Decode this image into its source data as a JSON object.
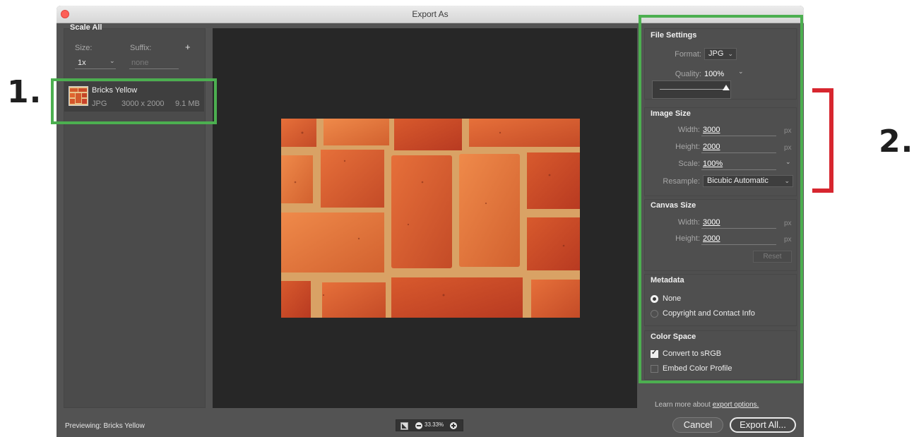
{
  "window": {
    "title": "Export As"
  },
  "annotations": {
    "label1": "1.",
    "label2": "2."
  },
  "left_panel": {
    "group_title": "Scale All",
    "size_label": "Size:",
    "suffix_label": "Suffix:",
    "add_symbol": "+",
    "size_value": "1x",
    "suffix_placeholder": "none",
    "asset": {
      "name": "Bricks Yellow",
      "format": "JPG",
      "dimensions": "3000 x 2000",
      "file_size": "9.1 MB"
    }
  },
  "file_settings": {
    "title": "File Settings",
    "format_label": "Format:",
    "format_value": "JPG",
    "quality_label": "Quality:",
    "quality_value": "100%",
    "quality_level": 1.0
  },
  "image_size": {
    "title": "Image Size",
    "width_label": "Width:",
    "width_value": "3000",
    "height_label": "Height:",
    "height_value": "2000",
    "scale_label": "Scale:",
    "scale_value": "100%",
    "resample_label": "Resample:",
    "resample_value": "Bicubic Automatic",
    "unit": "px"
  },
  "canvas_size": {
    "title": "Canvas Size",
    "width_label": "Width:",
    "width_value": "3000",
    "height_label": "Height:",
    "height_value": "2000",
    "unit": "px",
    "reset_label": "Reset"
  },
  "metadata": {
    "title": "Metadata",
    "options": [
      {
        "label": "None",
        "selected": true
      },
      {
        "label": "Copyright and Contact Info",
        "selected": false
      }
    ]
  },
  "color_space": {
    "title": "Color Space",
    "options": [
      {
        "label": "Convert to sRGB",
        "checked": true
      },
      {
        "label": "Embed Color Profile",
        "checked": false
      }
    ]
  },
  "footer": {
    "learn_more_prefix": "Learn more about ",
    "learn_more_link": "export options.",
    "previewing": "Previewing: Bricks Yellow",
    "zoom": "33.33%",
    "cancel": "Cancel",
    "export_all": "Export All..."
  },
  "icons": {
    "close": "close-dot-icon",
    "chevron": "chevron-down-icon",
    "zoom_out": "minus-circle-icon",
    "zoom_in": "plus-circle-icon",
    "toggle": "toggle-background-icon"
  },
  "colors": {
    "annotation_green": "#4caf50",
    "annotation_red": "#d7262f",
    "panel_bg": "#535353",
    "preview_bg": "#272727"
  }
}
